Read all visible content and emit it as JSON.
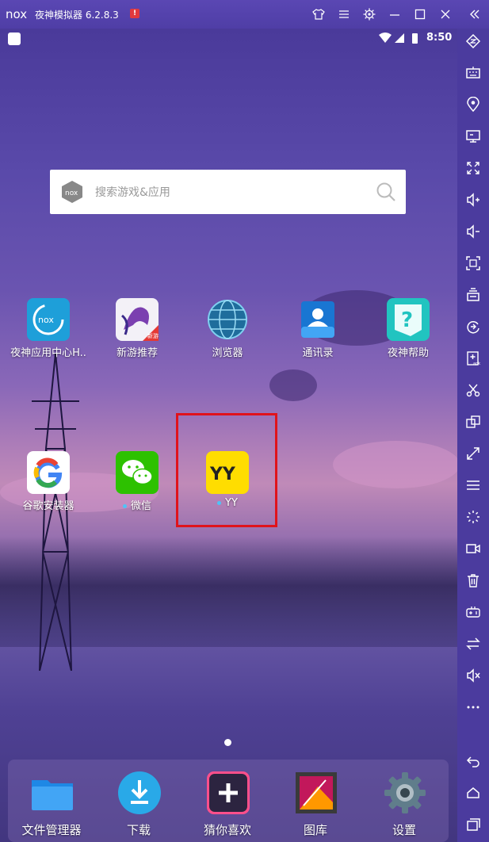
{
  "window": {
    "logo_text": "nox",
    "title": "夜神模拟器 6.2.8.3",
    "warning_badge": "!"
  },
  "statusbar": {
    "time": "8:50"
  },
  "search": {
    "placeholder": "搜索游戏&应用",
    "logo_text": "nox"
  },
  "apps": [
    {
      "label": "夜神应用中心H..",
      "icon": "nox-app-center-icon"
    },
    {
      "label": "新游推荐",
      "icon": "new-games-icon",
      "badge": "新游"
    },
    {
      "label": "浏览器",
      "icon": "browser-globe-icon"
    },
    {
      "label": "通讯录",
      "icon": "contacts-icon"
    },
    {
      "label": "夜神帮助",
      "icon": "nox-help-icon"
    },
    {
      "label": "谷歌安装器",
      "icon": "google-installer-icon"
    },
    {
      "label": "微信",
      "icon": "wechat-icon",
      "new": true
    },
    {
      "label": "YY",
      "icon": "yy-icon",
      "icon_text": "YY",
      "new": true
    }
  ],
  "dock": [
    {
      "label": "文件管理器",
      "icon": "file-manager-icon"
    },
    {
      "label": "下载",
      "icon": "download-icon"
    },
    {
      "label": "猜你喜欢",
      "icon": "recommend-plus-icon"
    },
    {
      "label": "图库",
      "icon": "gallery-icon"
    },
    {
      "label": "设置",
      "icon": "settings-gear-icon"
    }
  ],
  "colors": {
    "titlebar": "#5a47b3",
    "sidebar": "#4b3b9e",
    "highlight": "#e0131b",
    "yy_yellow": "#ffdd00",
    "wechat_green": "#2dc100"
  }
}
